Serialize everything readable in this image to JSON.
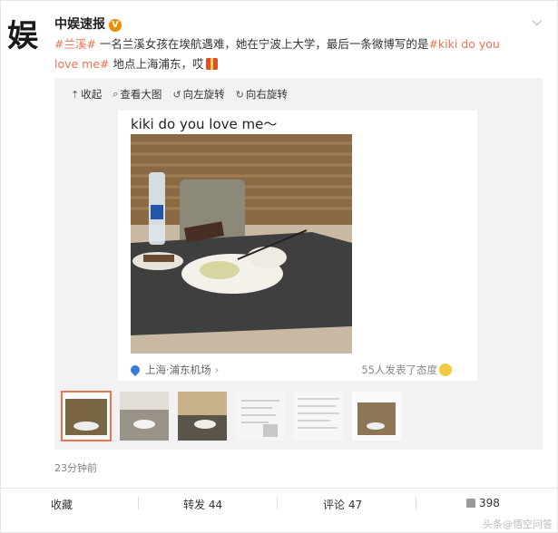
{
  "post": {
    "avatar_text": "娱",
    "author": "中娱速报",
    "verified_badge": "V",
    "text_topic1": "#兰溪#",
    "text_body": " 一名兰溪女孩在埃航遇难，她在宁波上大学，最后一条微博写的是",
    "text_topic2": "#kiki do you love me#",
    "text_tail": " 地点上海浦东，哎",
    "time": "23分钟前"
  },
  "toolbar": {
    "collapse": "收起",
    "view_large": "查看大图",
    "rotate_left": "向左旋转",
    "rotate_right": "向右旋转"
  },
  "photo_card": {
    "caption": "kiki do you love me～",
    "location": "上海·浦东机场",
    "location_count": "55人发表了态度"
  },
  "actions": {
    "favorite": "收藏",
    "repost": "转发 44",
    "comment": "评论 47",
    "like": "398"
  },
  "watermark": "头条@悟空问答",
  "colors": {
    "topic": "#eb7350",
    "verified": "#f08a00",
    "location_pin": "#3a7bd5"
  },
  "icons": {
    "collapse": "arrow-up-icon",
    "view_large": "zoom-icon",
    "rotate_left": "rotate-left-icon",
    "rotate_right": "rotate-right-icon",
    "expand": "chevron-down-icon",
    "location": "location-pin-icon",
    "like": "thumbs-up-icon"
  }
}
